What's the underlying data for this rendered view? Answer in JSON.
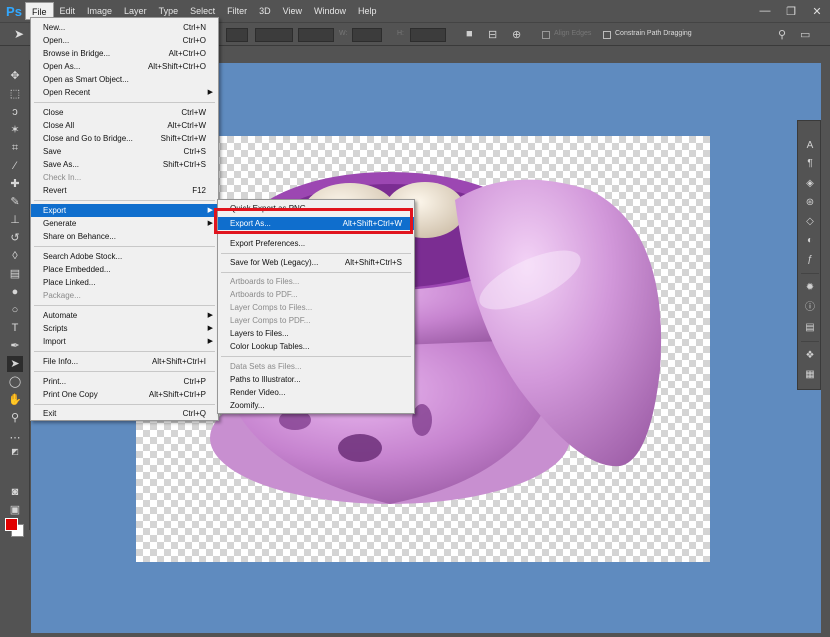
{
  "app": {
    "logo": "Ps"
  },
  "menubar": {
    "items": [
      "File",
      "Edit",
      "Image",
      "Layer",
      "Type",
      "Select",
      "Filter",
      "3D",
      "View",
      "Window",
      "Help"
    ],
    "win_minimize": "—",
    "win_maximize": "❐",
    "win_close": "✕"
  },
  "options": {
    "align_edges": "Align Edges",
    "constrain": "Constrain Path Dragging",
    "w_label": "W:",
    "h_label": "H:"
  },
  "file_menu": {
    "items": [
      {
        "label": "New...",
        "shortcut": "Ctrl+N"
      },
      {
        "label": "Open...",
        "shortcut": "Ctrl+O"
      },
      {
        "label": "Browse in Bridge...",
        "shortcut": "Alt+Ctrl+O"
      },
      {
        "label": "Open As...",
        "shortcut": "Alt+Shift+Ctrl+O"
      },
      {
        "label": "Open as Smart Object...",
        "shortcut": ""
      },
      {
        "label": "Open Recent",
        "shortcut": ""
      },
      {
        "label": "Close",
        "shortcut": "Ctrl+W"
      },
      {
        "label": "Close All",
        "shortcut": "Alt+Ctrl+W"
      },
      {
        "label": "Close and Go to Bridge...",
        "shortcut": "Shift+Ctrl+W"
      },
      {
        "label": "Save",
        "shortcut": "Ctrl+S"
      },
      {
        "label": "Save As...",
        "shortcut": "Shift+Ctrl+S"
      },
      {
        "label": "Check In...",
        "shortcut": ""
      },
      {
        "label": "Revert",
        "shortcut": "F12"
      },
      {
        "label": "Export",
        "shortcut": ""
      },
      {
        "label": "Generate",
        "shortcut": ""
      },
      {
        "label": "Share on Behance...",
        "shortcut": ""
      },
      {
        "label": "Search Adobe Stock...",
        "shortcut": ""
      },
      {
        "label": "Place Embedded...",
        "shortcut": ""
      },
      {
        "label": "Place Linked...",
        "shortcut": ""
      },
      {
        "label": "Package...",
        "shortcut": ""
      },
      {
        "label": "Automate",
        "shortcut": ""
      },
      {
        "label": "Scripts",
        "shortcut": ""
      },
      {
        "label": "Import",
        "shortcut": ""
      },
      {
        "label": "File Info...",
        "shortcut": "Alt+Shift+Ctrl+I"
      },
      {
        "label": "Print...",
        "shortcut": "Ctrl+P"
      },
      {
        "label": "Print One Copy",
        "shortcut": "Alt+Shift+Ctrl+P"
      },
      {
        "label": "Exit",
        "shortcut": "Ctrl+Q"
      }
    ]
  },
  "export_menu": {
    "items": [
      {
        "label": "Quick Export as PNG",
        "shortcut": ""
      },
      {
        "label": "Export As...",
        "shortcut": "Alt+Shift+Ctrl+W"
      },
      {
        "label": "Export Preferences...",
        "shortcut": ""
      },
      {
        "label": "Save for Web (Legacy)...",
        "shortcut": "Alt+Shift+Ctrl+S"
      },
      {
        "label": "Artboards to Files...",
        "shortcut": ""
      },
      {
        "label": "Artboards to PDF...",
        "shortcut": ""
      },
      {
        "label": "Layer Comps to Files...",
        "shortcut": ""
      },
      {
        "label": "Layer Comps to PDF...",
        "shortcut": ""
      },
      {
        "label": "Layers to Files...",
        "shortcut": ""
      },
      {
        "label": "Color Lookup Tables...",
        "shortcut": ""
      },
      {
        "label": "Data Sets as Files...",
        "shortcut": ""
      },
      {
        "label": "Paths to Illustrator...",
        "shortcut": ""
      },
      {
        "label": "Render Video...",
        "shortcut": ""
      },
      {
        "label": "Zoomify...",
        "shortcut": ""
      }
    ]
  },
  "colors": {
    "foreground": "#e00000",
    "background": "#ffffff",
    "highlight": "#0f6ecd",
    "callout": "#e0141e",
    "workspace": "#5f8bbf"
  }
}
